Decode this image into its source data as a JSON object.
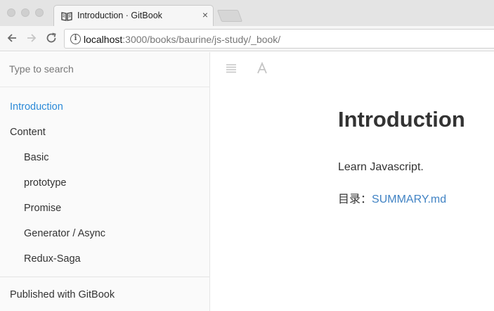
{
  "browser": {
    "tab": {
      "title": "Introduction · GitBook",
      "close": "×",
      "favicon": "book-icon"
    },
    "url": {
      "host": "localhost",
      "path": ":3000/books/baurine/js-study/_book/"
    },
    "icons": {
      "back": "back-arrow-icon",
      "forward": "forward-arrow-icon",
      "reload": "reload-icon",
      "info": "info-icon"
    }
  },
  "sidebar": {
    "search_placeholder": "Type to search",
    "items": [
      {
        "label": "Introduction",
        "active": true
      },
      {
        "label": "Content",
        "active": false
      },
      {
        "label": "Basic",
        "active": false
      },
      {
        "label": "prototype",
        "active": false
      },
      {
        "label": "Promise",
        "active": false
      },
      {
        "label": "Generator / Async",
        "active": false
      },
      {
        "label": "Redux-Saga",
        "active": false
      }
    ],
    "footer": "Published with GitBook"
  },
  "main": {
    "toolbar_icons": [
      "toc-toggle-icon",
      "font-settings-icon"
    ],
    "title": "Introduction",
    "paragraph": "Learn Javascript.",
    "toc_prefix": "目录：",
    "toc_link": "SUMMARY.md"
  },
  "colors": {
    "accent": "#2b8ad8",
    "link": "#4183c4",
    "text": "#333333"
  }
}
